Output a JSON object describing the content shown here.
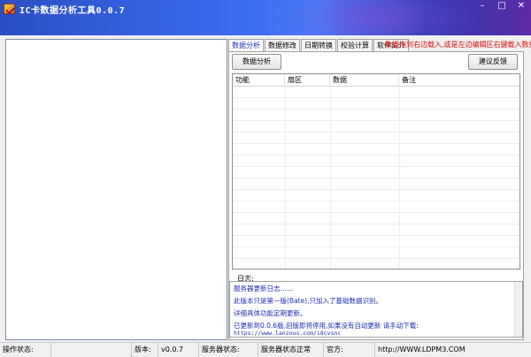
{
  "window": {
    "title": "IC卡数据分析工具0.0.7",
    "minimize": "–",
    "maximize": "□",
    "close": "✕"
  },
  "tabs": [
    {
      "label": "数据分析",
      "active": true
    },
    {
      "label": "数据修改",
      "active": false
    },
    {
      "label": "日期转换",
      "active": false
    },
    {
      "label": "校验计算",
      "active": false
    },
    {
      "label": "软件简介",
      "active": false
    }
  ],
  "tab_note": "数据拖到右边载入,或是左边编辑区右键载入数据",
  "buttons": {
    "analyze": "数据分析",
    "feedback": "建议反馈"
  },
  "table": {
    "columns": [
      "功能",
      "扇区",
      "数据",
      "备注"
    ]
  },
  "log": {
    "label": "日志:",
    "lines": [
      "服务器更新日志……",
      "此版本只是第一版(Bate),只加入了基础数据识别。",
      "详细具体功能定期更新。",
      "已更新到0.0.6版,旧版即将停用,如果没有自动更新 请手动下载:"
    ],
    "url": "https://www.lanzous.com/i8cvsnc"
  },
  "status": {
    "op_label": "操作状态:",
    "op_value": "",
    "version_label": "版本:",
    "version_value": "v0.0.7",
    "server_label": "服务器状态:",
    "server_value": "服务器状态正常",
    "official_label": "官方:",
    "official_value": "http://WWW.LDPM3.COM"
  },
  "colors": {
    "tab_note": "#e01010",
    "log_text": "#1c2fb0"
  }
}
